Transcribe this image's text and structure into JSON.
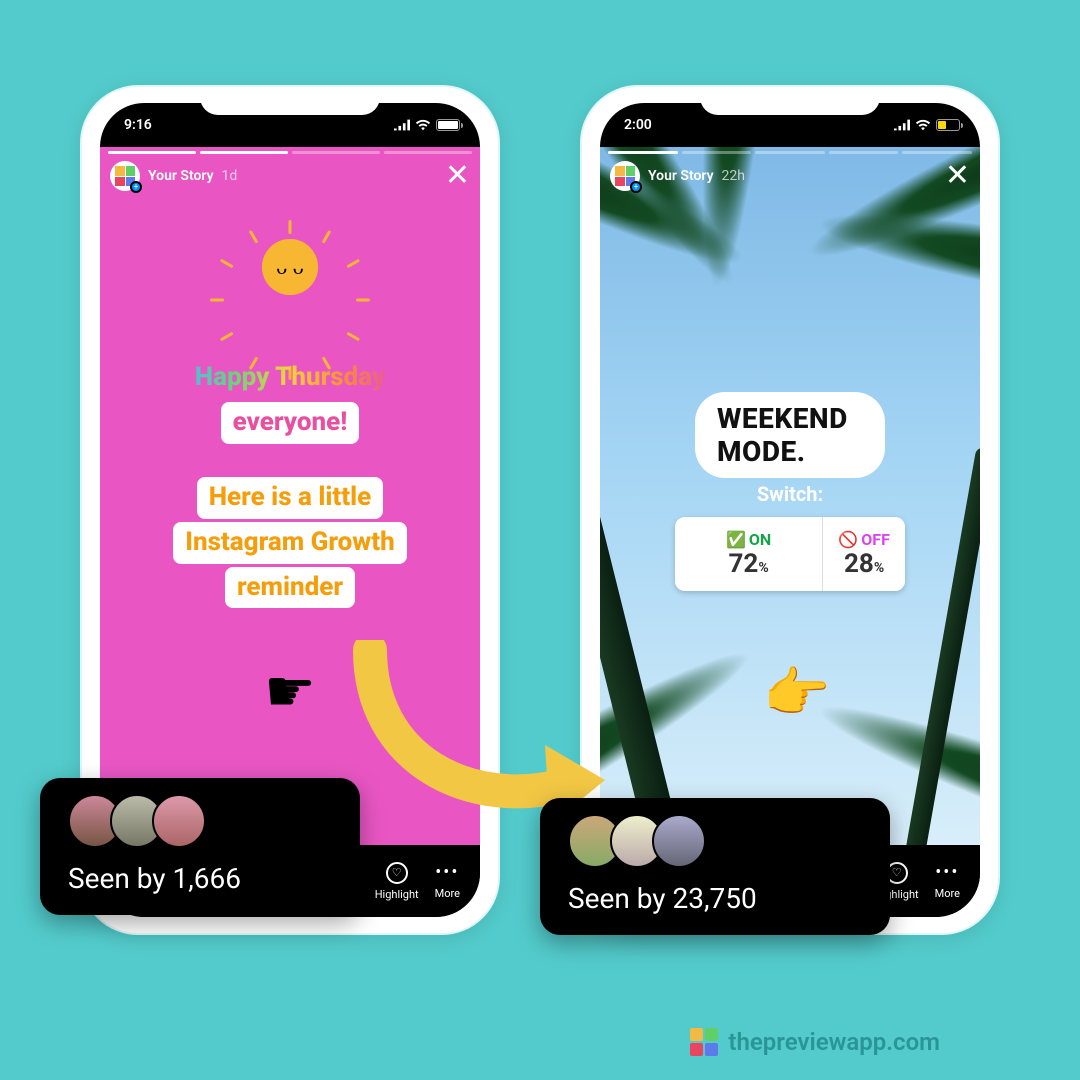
{
  "left_phone": {
    "time": "9:16",
    "story_name": "Your Story",
    "story_age": "1d",
    "close": "✕",
    "text1_line1": "Happy Thursday",
    "text1_line2": "everyone!",
    "text2_line1": "Here is a little",
    "text2_line2": "Instagram Growth",
    "text2_line3": "reminder",
    "pointer": "☛",
    "footer_highlight": "Highlight",
    "footer_more": "More",
    "seen_by_label": "Seen by 1,666"
  },
  "right_phone": {
    "time": "2:00",
    "story_name": "Your Story",
    "story_age": "22h",
    "close": "✕",
    "weekend_text": "WEEKEND MODE.",
    "switch_label": "Switch:",
    "poll_on_icon": "✅",
    "poll_on_label": "ON",
    "poll_on_pct": "72",
    "poll_off_icon": "🚫",
    "poll_off_label": "OFF",
    "poll_off_pct": "28",
    "poll_pct_suffix": "%",
    "pointer": "👉",
    "footer_highlight": "Highlight",
    "footer_more": "More",
    "seen_by_label": "Seen by 23,750"
  },
  "watermark": "thepreviewapp.com"
}
